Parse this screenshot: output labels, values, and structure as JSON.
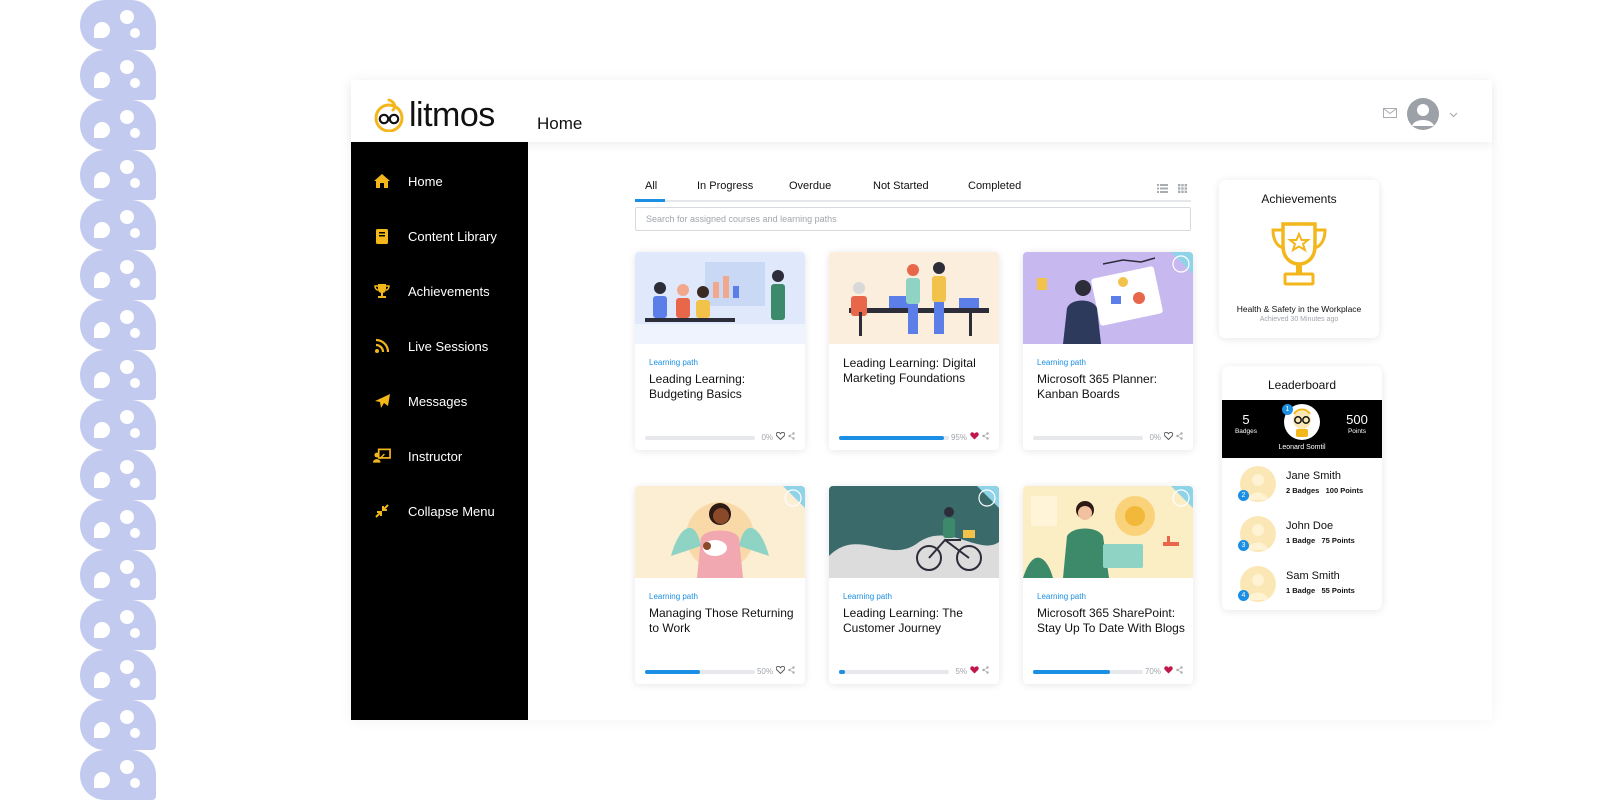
{
  "app": {
    "brand": "litmos",
    "page_title": "Home"
  },
  "header": {
    "mail_icon": "mail-icon",
    "avatar_icon": "user-avatar-icon",
    "menu_icon": "chevron-down-icon"
  },
  "sidebar": {
    "items": [
      {
        "label": "Home",
        "icon": "home-icon"
      },
      {
        "label": "Content Library",
        "icon": "book-icon"
      },
      {
        "label": "Achievements",
        "icon": "trophy-icon"
      },
      {
        "label": "Live Sessions",
        "icon": "rss-icon"
      },
      {
        "label": "Messages",
        "icon": "paper-plane-icon"
      },
      {
        "label": "Instructor",
        "icon": "instructor-icon"
      },
      {
        "label": "Collapse Menu",
        "icon": "collapse-icon"
      }
    ]
  },
  "tabs": [
    {
      "label": "All",
      "active": true
    },
    {
      "label": "In Progress"
    },
    {
      "label": "Overdue"
    },
    {
      "label": "Not Started"
    },
    {
      "label": "Completed"
    }
  ],
  "search": {
    "placeholder": "Search for assigned courses and learning paths"
  },
  "courses": [
    {
      "type": "Learning path",
      "title": "Leading Learning: Budgeting Basics",
      "progress": "0%",
      "progress_value": 0,
      "liked": false
    },
    {
      "type": "",
      "title": "Leading Learning: Digital Marketing Foundations",
      "progress": "95%",
      "progress_value": 95,
      "liked": true
    },
    {
      "type": "Learning path",
      "title": "Microsoft 365 Planner: Kanban Boards",
      "progress": "0%",
      "progress_value": 0,
      "liked": false
    },
    {
      "type": "Learning path",
      "title": "Managing Those Returning to Work",
      "progress": "50%",
      "progress_value": 50,
      "liked": false
    },
    {
      "type": "Learning path",
      "title": "Leading Learning: The Customer Journey",
      "progress": "5%",
      "progress_value": 5,
      "liked": true
    },
    {
      "type": "Learning path",
      "title": "Microsoft 365 SharePoint: Stay Up To Date With Blogs",
      "progress": "70%",
      "progress_value": 70,
      "liked": true
    }
  ],
  "achievements": {
    "title": "Achievements",
    "course": "Health & Safety in the Workplace",
    "time": "Achieved 30 Minutes ago"
  },
  "leaderboard": {
    "title": "Leaderboard",
    "top": {
      "badges": "5",
      "badges_label": "Badges",
      "points": "500",
      "points_label": "Points",
      "name": "Leonard Somtil",
      "rank": "1"
    },
    "rows": [
      {
        "rank": "2",
        "name": "Jane Smith",
        "badges": "2 Badges",
        "points": "100 Points"
      },
      {
        "rank": "3",
        "name": "John Doe",
        "badges": "1 Badge",
        "points": "75 Points"
      },
      {
        "rank": "4",
        "name": "Sam Smith",
        "badges": "1 Badge",
        "points": "55 Points"
      }
    ]
  },
  "colors": {
    "accent": "#1a8fe3",
    "brand_yellow": "#f3b71c",
    "sidebar_bg": "#000000",
    "heart": "#c0184a",
    "decor": "#c3caf0"
  }
}
